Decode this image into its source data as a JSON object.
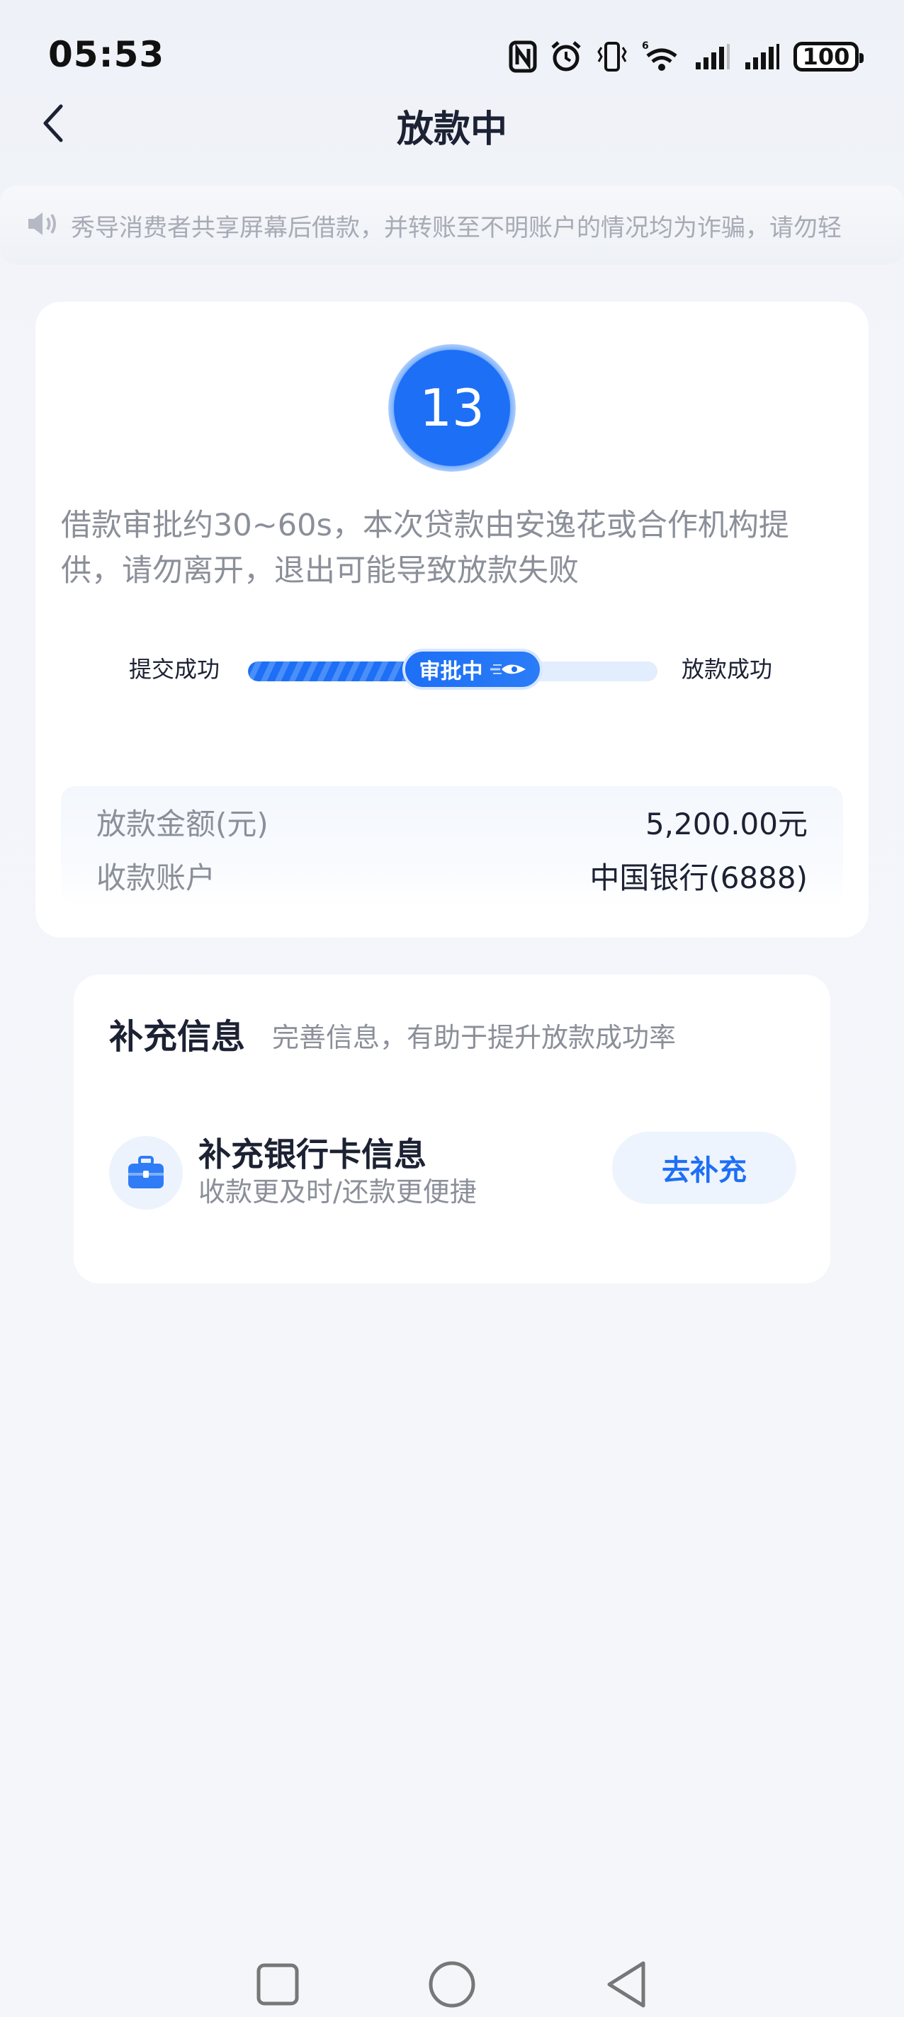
{
  "status_bar": {
    "time": "05:53",
    "battery": "100",
    "icons": [
      "nfc-icon",
      "alarm-icon",
      "vibrate-icon",
      "wifi-6-icon",
      "signal-icon",
      "signal-icon"
    ]
  },
  "nav": {
    "title": "放款中",
    "back_icon": "chevron-left-icon"
  },
  "notice": {
    "icon": "speaker-icon",
    "text": "秀导消费者共享屏幕后借款，并转账至不明账户的情况均为诈骗，请勿轻"
  },
  "main_card": {
    "countdown": "13",
    "approval_text": "借款审批约30~60s，本次贷款由安逸花或合作机构提供，请勿离开，退出可能导致放款失败",
    "progress": {
      "left_label": "提交成功",
      "right_label": "放款成功",
      "current_label": "审批中",
      "fill_fraction": 0.52
    },
    "loan_info": [
      {
        "label": "放款金额(元)",
        "value": "5,200.00元"
      },
      {
        "label": "收款账户",
        "value": "中国银行(6888)"
      }
    ]
  },
  "supplement": {
    "title": "补充信息",
    "subtitle": "完善信息，有助于提升放款成功率",
    "item_title": "补充银行卡信息",
    "item_desc": "收款更及时/还款更便捷",
    "button_label": "去补充"
  },
  "colors": {
    "brand_blue": "#1d6ff5",
    "text_dark": "#1c2233",
    "text_gray": "#8b8f99",
    "background": "#f4f6fa"
  }
}
